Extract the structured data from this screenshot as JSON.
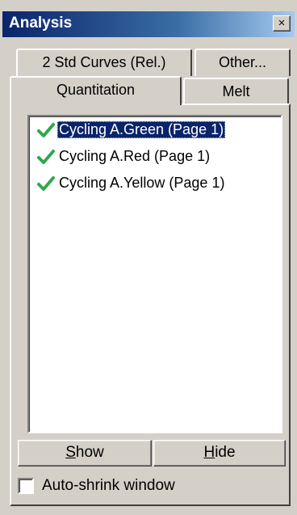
{
  "window": {
    "title": "Analysis",
    "close_glyph": "×"
  },
  "tabs": {
    "row_back": [
      {
        "label": "2 Std Curves (Rel.)"
      },
      {
        "label": "Other..."
      }
    ],
    "row_front": [
      {
        "label": "Quantitation",
        "selected": true
      },
      {
        "label": "Melt"
      }
    ]
  },
  "list": {
    "items": [
      {
        "label": "Cycling A.Green (Page 1)",
        "icon": "green-check-icon",
        "selected": true
      },
      {
        "label": "Cycling A.Red (Page 1)",
        "icon": "green-check-icon",
        "selected": false
      },
      {
        "label": "Cycling A.Yellow (Page 1)",
        "icon": "green-check-icon",
        "selected": false
      }
    ]
  },
  "buttons": {
    "show": {
      "accel": "S",
      "rest": "how"
    },
    "hide": {
      "accel": "H",
      "rest": "ide"
    }
  },
  "auto_shrink": {
    "label": "Auto-shrink window",
    "checked": false
  },
  "colors": {
    "title_bar": "#0a246a",
    "selection": "#0a246a",
    "check": "#2fa84f",
    "face": "#d4d0c8"
  }
}
